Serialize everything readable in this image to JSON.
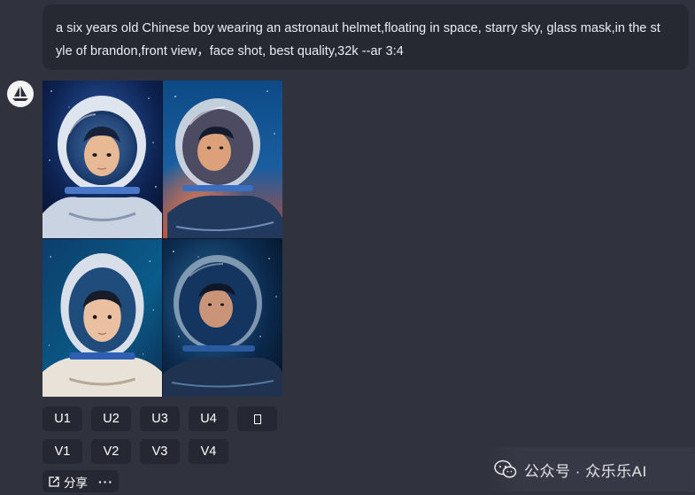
{
  "prompt": {
    "line1": "a six years old Chinese boy wearing an astronaut helmet,floating in space, starry sky, glass mask,in the st",
    "line2": "yle of brandon,front view，face shot, best quality,32k --ar 3:4"
  },
  "bot": {
    "avatar_icon": "sailboat-icon"
  },
  "images": [
    {
      "id": "1",
      "theme": "blue"
    },
    {
      "id": "2",
      "theme": "blue-orange"
    },
    {
      "id": "3",
      "theme": "teal"
    },
    {
      "id": "4",
      "theme": "dark-blue"
    }
  ],
  "upscale_buttons": [
    "U1",
    "U2",
    "U3",
    "U4"
  ],
  "variation_buttons": [
    "V1",
    "V2",
    "V3",
    "V4"
  ],
  "share": {
    "label": "分享",
    "more": "···"
  },
  "watermark": {
    "text": "公众号 · 众乐乐AI"
  },
  "colors": {
    "background": "#30323e",
    "bubble": "#262832",
    "button": "#252732",
    "text": "#eceef5"
  }
}
